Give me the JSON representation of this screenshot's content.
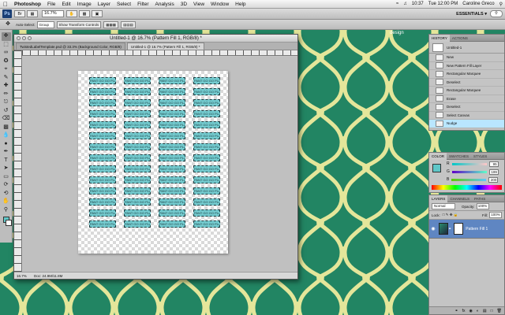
{
  "menubar": {
    "app": "Photoshop",
    "items": [
      "File",
      "Edit",
      "Image",
      "Layer",
      "Select",
      "Filter",
      "Analysis",
      "3D",
      "View",
      "Window",
      "Help"
    ],
    "status": {
      "clock": "Tue 12:00 PM",
      "battery": "10:37",
      "user": "Caroline Greco"
    }
  },
  "appbar": {
    "logo": "Ps",
    "zoom": "16.7%",
    "workspace": "ESSENTIALS ▾"
  },
  "options": {
    "auto_select": "Auto-Select:",
    "group": "Group",
    "transform": "Show Transform Controls"
  },
  "document": {
    "title": "Untitled-1 @ 16.7% (Pattern Fill 1, RGB/8) *",
    "tabs": [
      "TwistedLabelTemplate.psd @ 33.3% (Background Color, RGB/8)",
      "Untitled-1 @ 16.7% (Pattern Fill 1, RGB/8) *"
    ],
    "status_zoom": "16.7%",
    "status_doc": "Doc: 24.9M/11.8M",
    "label_text": "PANT GO GO PLANT"
  },
  "bg_label": "design",
  "history": {
    "tabs": [
      "HISTORY",
      "ACTIONS"
    ],
    "snapshot": "Untitled-1",
    "steps": [
      "New",
      "New Pattern Fill Layer",
      "Rectangular Marquee",
      "Deselect",
      "Rectangular Marquee",
      "Erase",
      "Deselect",
      "Select Canvas",
      "Nudge"
    ]
  },
  "color": {
    "tabs": [
      "COLOR",
      "SWATCHES",
      "STYLES"
    ],
    "channels": [
      {
        "name": "R",
        "value": "95"
      },
      {
        "name": "G",
        "value": "199"
      },
      {
        "name": "B",
        "value": "200"
      }
    ]
  },
  "layers": {
    "tabs": [
      "LAYERS",
      "CHANNELS",
      "PATHS"
    ],
    "blend": "Normal",
    "opacity_label": "Opacity:",
    "opacity": "100%",
    "fill_label": "Fill:",
    "fill": "100%",
    "lock_label": "Lock:",
    "layer_name": "Pattern Fill 1"
  },
  "colors": {
    "pattern_navy": "#1e2a3d",
    "pattern_green": "#228563",
    "pattern_cream": "#e4e69a",
    "label_cyan": "#74cbcf",
    "fg_color": "#5fc7c8"
  }
}
